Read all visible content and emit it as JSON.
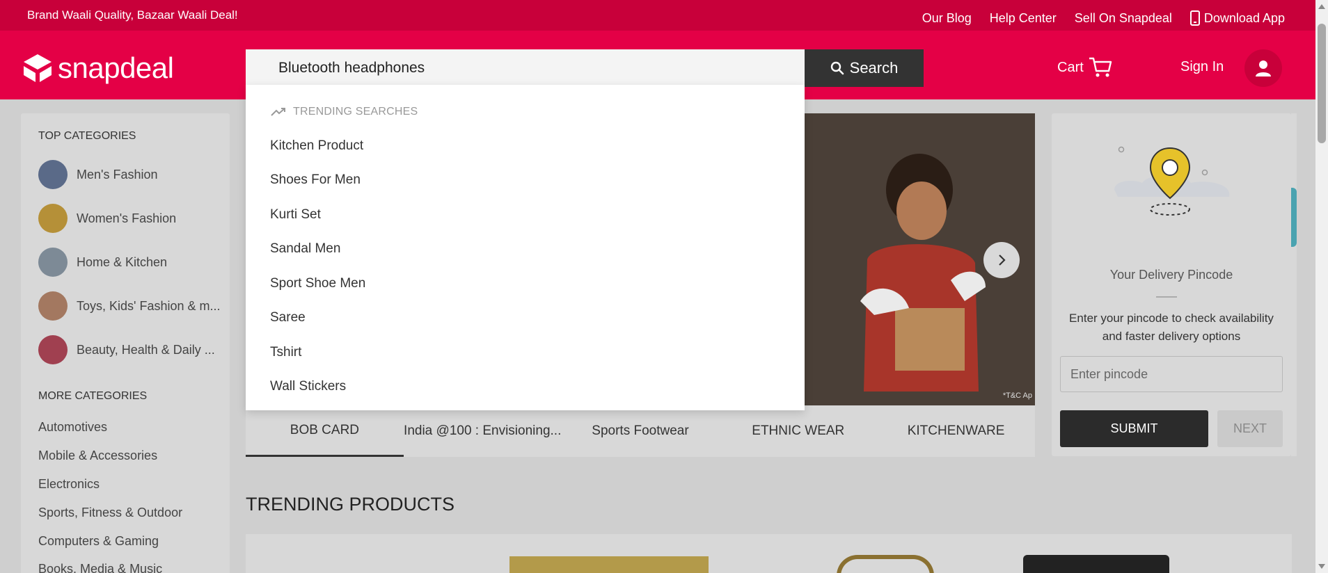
{
  "top_strip": {
    "tagline": "Brand Waali Quality, Bazaar Waali Deal!",
    "links": [
      "Our Blog",
      "Help Center",
      "Sell On Snapdeal",
      "Download App"
    ]
  },
  "header": {
    "logo_text": "snapdeal",
    "search_value": "Bluetooth headphones",
    "search_button": "Search",
    "cart_label": "Cart",
    "signin_label": "Sign In"
  },
  "dropdown": {
    "heading": "TRENDING SEARCHES",
    "items": [
      "Kitchen Product",
      "Shoes For Men",
      "Kurti Set",
      "Sandal Men",
      "Sport Shoe Men",
      "Saree",
      "Tshirt",
      "Wall Stickers"
    ]
  },
  "sidebar": {
    "top_heading": "TOP CATEGORIES",
    "top_items": [
      "Men's Fashion",
      "Women's Fashion",
      "Home & Kitchen",
      "Toys, Kids' Fashion & m...",
      "Beauty, Health & Daily ..."
    ],
    "more_heading": "MORE CATEGORIES",
    "more_items": [
      "Automotives",
      "Mobile & Accessories",
      "Electronics",
      "Sports, Fitness & Outdoor",
      "Computers & Gaming",
      "Books, Media & Music"
    ]
  },
  "banner": {
    "note": "*T&C Ap"
  },
  "tabs": [
    "BOB CARD",
    "India @100 : Envisioning...",
    "Sports Footwear",
    "ETHNIC WEAR",
    "KITCHENWARE"
  ],
  "trending_title": "TRENDING PRODUCTS",
  "pincode": {
    "title": "Your Delivery Pincode",
    "description": "Enter your pincode to check availability and faster delivery options",
    "placeholder": "Enter pincode",
    "submit_label": "SUBMIT",
    "next_label": "NEXT"
  },
  "colors": {
    "brand_red": "#e40046",
    "top_strip": "#c8003a",
    "dark_button": "#333333"
  }
}
